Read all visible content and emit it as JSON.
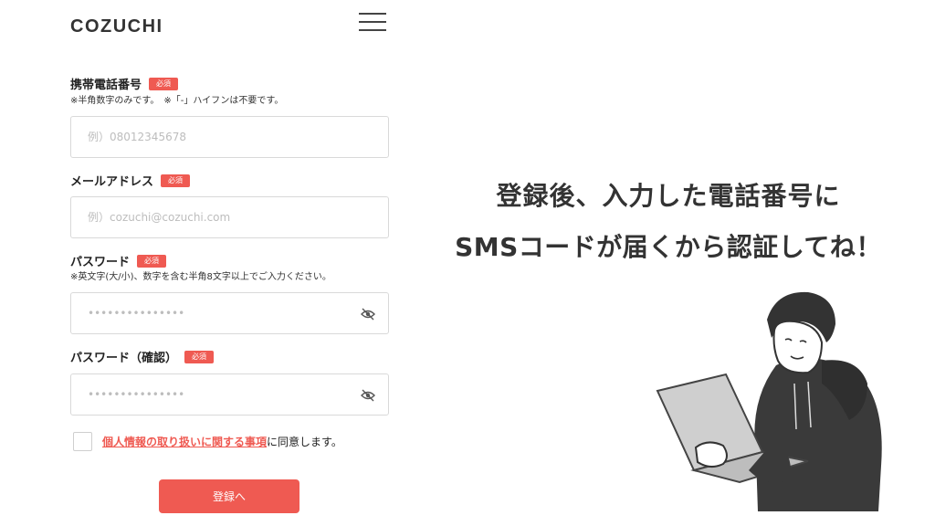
{
  "header": {
    "logo": "COZUCHI",
    "menu_icon": "hamburger-menu-icon"
  },
  "form": {
    "required_badge": "必須",
    "phone": {
      "label": "携帯電話番号",
      "note": "※半角数字のみです。　※「-」ハイフンは不要です。",
      "placeholder": "例）08012345678"
    },
    "email": {
      "label": "メールアドレス",
      "placeholder": "例）cozuchi@cozuchi.com"
    },
    "password": {
      "label": "パスワード",
      "note": "※英文字(大/小)、数字を含む半角8文字以上でご入力ください。",
      "placeholder": "•••••••••••••••",
      "toggle_icon": "eye-slash-icon"
    },
    "password_confirm": {
      "label": "パスワード（確認）",
      "placeholder": "•••••••••••••••",
      "toggle_icon": "eye-slash-icon"
    },
    "agreement": {
      "link": "個人情報の取り扱いに関する事項",
      "suffix": "に同意します。"
    },
    "submit_label": "登録へ"
  },
  "message": {
    "line1": "登録後、入力した電話番号に",
    "line2": "SMSコードが届くから認証してね！"
  },
  "colors": {
    "accent": "#ef5a52",
    "text": "#222222",
    "border": "#d9d9d9"
  }
}
